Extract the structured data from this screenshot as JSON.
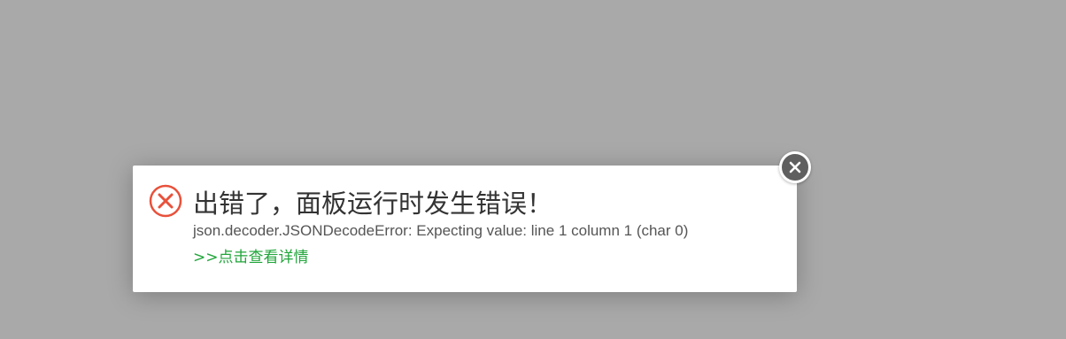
{
  "dialog": {
    "title": "出错了，面板运行时发生错误！",
    "error_message": "json.decoder.JSONDecodeError: Expecting value: line 1 column 1 (char 0)",
    "details_link": ">>点击查看详情",
    "icon": "error-circle-x-icon",
    "close_icon": "close-icon"
  },
  "colors": {
    "overlay": "#a9a9a9",
    "dialog_bg": "#ffffff",
    "error_red": "#e8513b",
    "link_green": "#20a53a",
    "close_bg": "#5f5f5f"
  }
}
